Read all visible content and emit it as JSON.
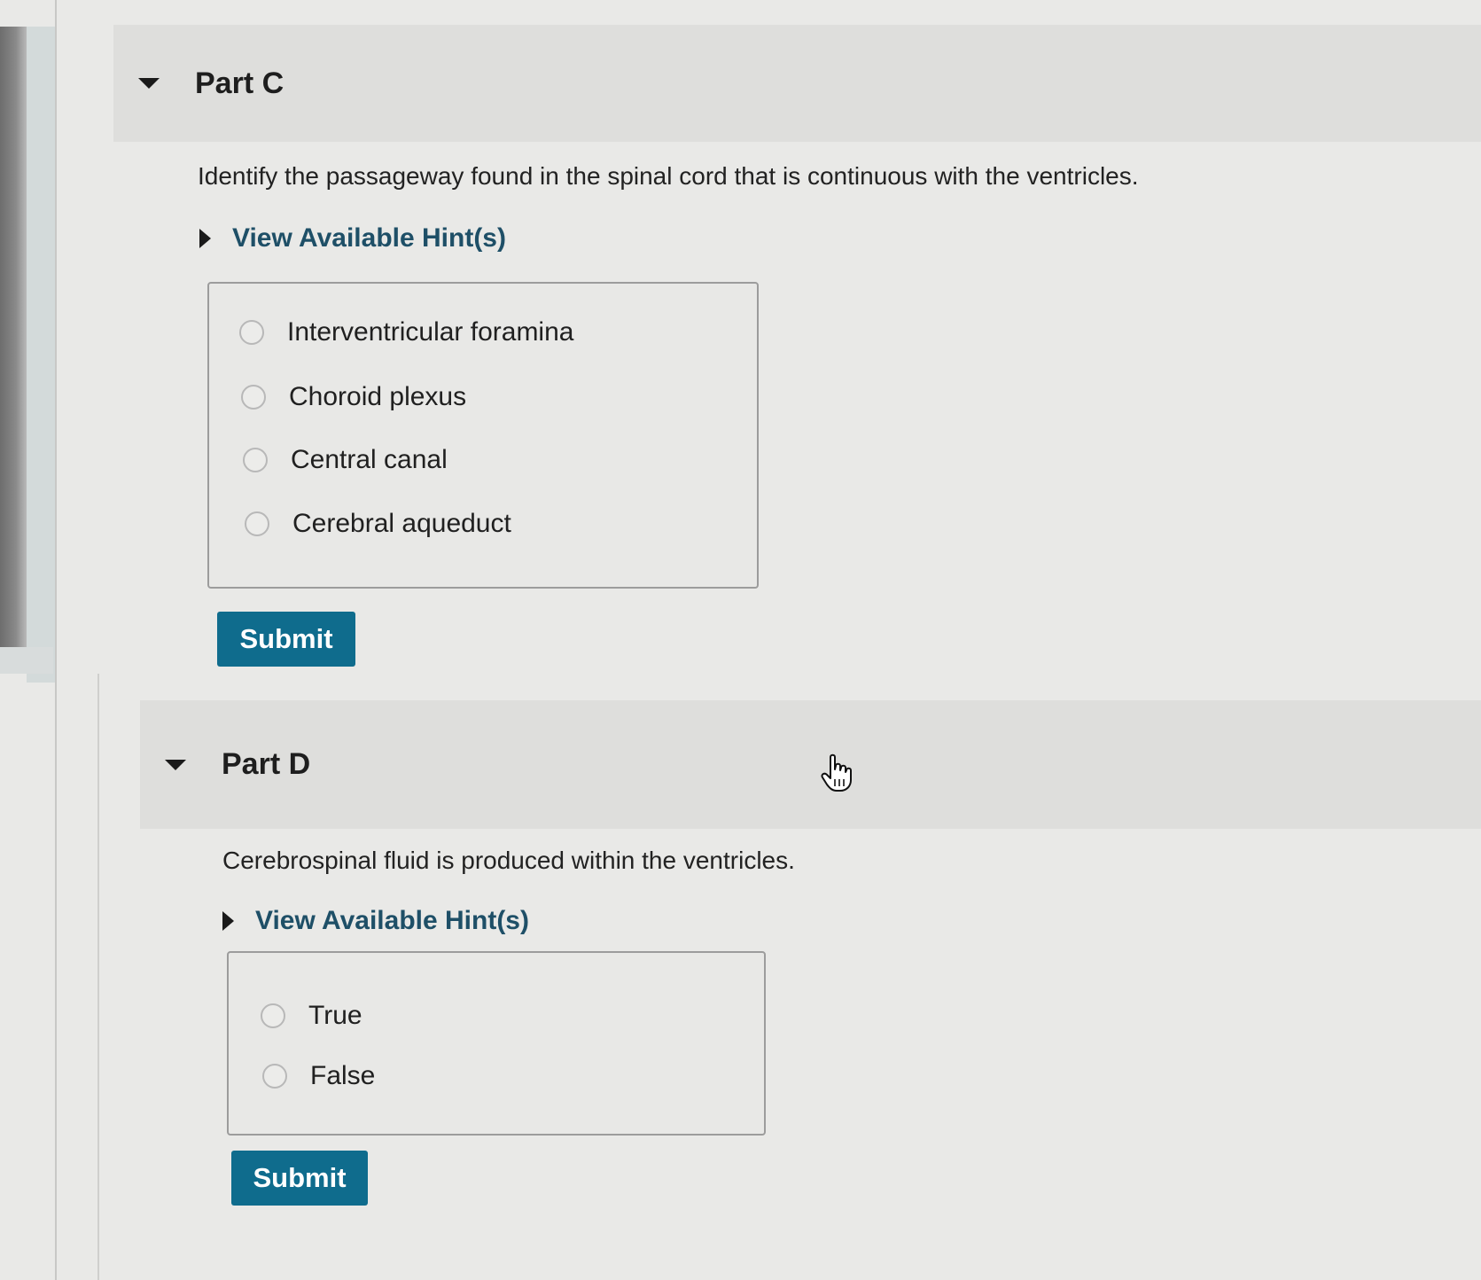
{
  "part_c": {
    "title": "Part C",
    "question": "Identify the passageway found in the spinal cord that is continuous with the ventricles.",
    "hint_label": "View Available Hint(s)",
    "choices": [
      {
        "label": "Interventricular foramina"
      },
      {
        "label": "Choroid plexus"
      },
      {
        "label": "Central canal"
      },
      {
        "label": "Cerebral aqueduct"
      }
    ],
    "submit_label": "Submit"
  },
  "part_d": {
    "title": "Part D",
    "question": "Cerebrospinal fluid is produced within the ventricles.",
    "hint_label": "View Available Hint(s)",
    "choices": [
      {
        "label": "True"
      },
      {
        "label": "False"
      }
    ],
    "submit_label": "Submit"
  },
  "colors": {
    "accent": "#0f6c8d",
    "hint_link": "#1e4f67",
    "background": "#e9e9e7"
  },
  "icons": {
    "part_toggle": "caret-down-icon",
    "hint_toggle": "caret-right-icon",
    "cursor": "hand-pointer-icon"
  }
}
